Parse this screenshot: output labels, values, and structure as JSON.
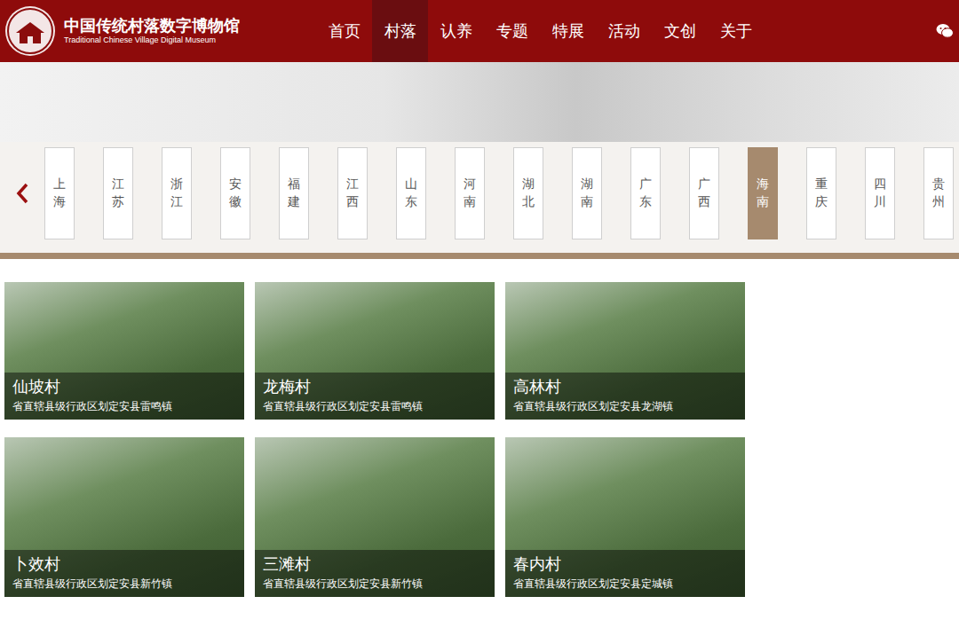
{
  "site": {
    "title": "中国传统村落数字博物馆",
    "subtitle": "Traditional Chinese Village Digital Museum"
  },
  "nav": [
    {
      "label": "首页",
      "selected": false
    },
    {
      "label": "村落",
      "selected": true
    },
    {
      "label": "认养",
      "selected": false
    },
    {
      "label": "专题",
      "selected": false
    },
    {
      "label": "特展",
      "selected": false
    },
    {
      "label": "活动",
      "selected": false
    },
    {
      "label": "文创",
      "selected": false
    },
    {
      "label": "关于",
      "selected": false
    }
  ],
  "provinces": [
    {
      "label": "上海",
      "selected": false
    },
    {
      "label": "江苏",
      "selected": false
    },
    {
      "label": "浙江",
      "selected": false
    },
    {
      "label": "安徽",
      "selected": false
    },
    {
      "label": "福建",
      "selected": false
    },
    {
      "label": "江西",
      "selected": false
    },
    {
      "label": "山东",
      "selected": false
    },
    {
      "label": "河南",
      "selected": false
    },
    {
      "label": "湖北",
      "selected": false
    },
    {
      "label": "湖南",
      "selected": false
    },
    {
      "label": "广东",
      "selected": false
    },
    {
      "label": "广西",
      "selected": false
    },
    {
      "label": "海南",
      "selected": true
    },
    {
      "label": "重庆",
      "selected": false
    },
    {
      "label": "四川",
      "selected": false
    },
    {
      "label": "贵州",
      "selected": false
    }
  ],
  "villages": [
    {
      "name": "仙坡村",
      "location": "省直辖县级行政区划定安县雷鸣镇"
    },
    {
      "name": "龙梅村",
      "location": "省直辖县级行政区划定安县雷鸣镇"
    },
    {
      "name": "高林村",
      "location": "省直辖县级行政区划定安县龙湖镇"
    },
    {
      "name": "卜效村",
      "location": "省直辖县级行政区划定安县新竹镇"
    },
    {
      "name": "三滩村",
      "location": "省直辖县级行政区划定安县新竹镇"
    },
    {
      "name": "春内村",
      "location": "省直辖县级行政区划定安县定城镇"
    }
  ]
}
